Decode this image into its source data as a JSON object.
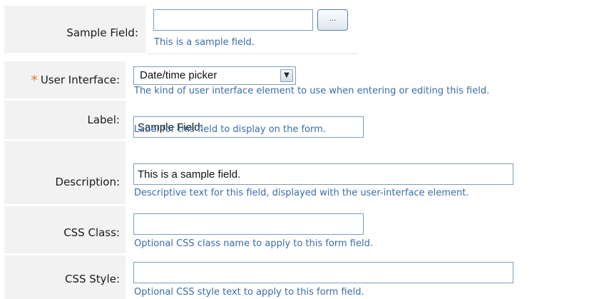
{
  "sample": {
    "label": "Sample Field:",
    "input_value": "",
    "browse_button_label": "...",
    "hint": "This is a sample field."
  },
  "fields": {
    "user_interface": {
      "required_marker": "*",
      "label": "User Interface:",
      "selected": "Date/time picker",
      "hint": "The kind of user interface element to use when entering or editing this field."
    },
    "label": {
      "label": "Label:",
      "value": "Sample Field:",
      "hint": "Label for this field to display on the form."
    },
    "description": {
      "label": "Description:",
      "value": "This is a sample field.",
      "hint": "Descriptive text for this field, displayed with the user-interface element."
    },
    "css_class": {
      "label": "CSS Class:",
      "value": "",
      "hint": "Optional CSS class name to apply to this form field."
    },
    "css_style": {
      "label": "CSS Style:",
      "value": "",
      "hint": "Optional CSS style text to apply to this form field."
    }
  },
  "colors": {
    "hint_text": "#3a6cab",
    "required_marker": "#e87722",
    "label_cell_bg": "#f2f2f2",
    "input_border": "#7f9db9"
  },
  "icons": {
    "dropdown_arrow": "chevron-down-icon"
  }
}
